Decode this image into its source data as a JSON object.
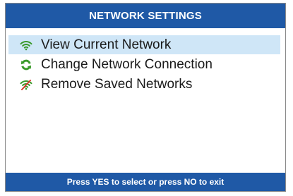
{
  "header": {
    "title": "NETWORK SETTINGS"
  },
  "menu": {
    "items": [
      {
        "label": "View Current Network",
        "icon": "wifi-icon",
        "selected": true
      },
      {
        "label": "Change Network Connection",
        "icon": "refresh-icon",
        "selected": false
      },
      {
        "label": "Remove Saved Networks",
        "icon": "wifi-off-icon",
        "selected": false
      }
    ]
  },
  "footer": {
    "hint": "Press YES to select or press NO to exit"
  },
  "colors": {
    "bar": "#1f59a6",
    "selection": "#cfe6f7",
    "icon_green": "#3a9a2a",
    "icon_red": "#d83a2a"
  }
}
